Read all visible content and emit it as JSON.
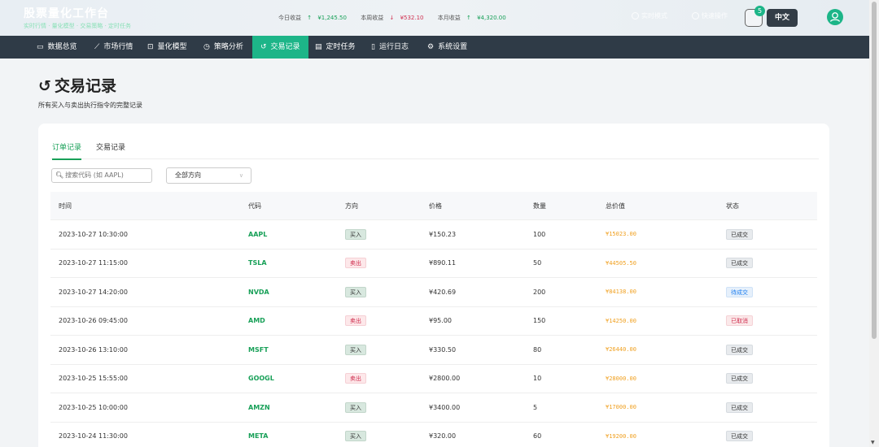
{
  "header": {
    "app_title": "股票量化工作台",
    "subtitle_links": "实时行情 · 量化模型 · 交易策略 · 定时任务",
    "stats": [
      {
        "label": "今日收益",
        "arrow": "↑",
        "value": "¥1,245.50",
        "trend": "up"
      },
      {
        "label": "本周收益",
        "arrow": "↓",
        "value": "¥532.10",
        "trend": "down"
      },
      {
        "label": "本月收益",
        "arrow": "↑",
        "value": "¥4,320.00",
        "trend": "up"
      }
    ],
    "ghost_action_1": "实时模式",
    "ghost_action_2": "快速操作",
    "notification_count": "5",
    "language_button": "中文",
    "avatar_icon": "user-icon"
  },
  "nav": {
    "items": [
      {
        "label": "数据总览",
        "icon": "monitor-icon",
        "glyph": "▭"
      },
      {
        "label": "市场行情",
        "icon": "trend-icon",
        "glyph": "⟋"
      },
      {
        "label": "量化模型",
        "icon": "chart-icon",
        "glyph": "⊡"
      },
      {
        "label": "策略分析",
        "icon": "clock-icon",
        "glyph": "◷"
      },
      {
        "label": "交易记录",
        "icon": "history-icon",
        "glyph": "↺"
      },
      {
        "label": "定时任务",
        "icon": "calendar-icon",
        "glyph": "▤"
      },
      {
        "label": "运行日志",
        "icon": "file-icon",
        "glyph": "▯"
      },
      {
        "label": "系统设置",
        "icon": "gear-icon",
        "glyph": "⚙"
      }
    ],
    "active_index": 4
  },
  "page": {
    "title": "交易记录",
    "title_icon": "↺",
    "description": "所有买入与卖出执行指令的完整记录"
  },
  "tabs": {
    "items": [
      "订单记录",
      "交易记录"
    ],
    "active_index": 0
  },
  "filters": {
    "search_placeholder": "搜索代码 (如 AAPL)",
    "direction_value": "全部方向"
  },
  "table": {
    "columns": [
      "时间",
      "代码",
      "方向",
      "价格",
      "数量",
      "总价值",
      "状态"
    ],
    "rows": [
      {
        "time": "2023-10-27 10:30:00",
        "code": "AAPL",
        "direction": "买入",
        "price": "¥150.23",
        "qty": "100",
        "total": "¥15023.00",
        "status": "已成交"
      },
      {
        "time": "2023-10-27 11:15:00",
        "code": "TSLA",
        "direction": "卖出",
        "price": "¥890.11",
        "qty": "50",
        "total": "¥44505.50",
        "status": "已成交"
      },
      {
        "time": "2023-10-27 14:20:00",
        "code": "NVDA",
        "direction": "买入",
        "price": "¥420.69",
        "qty": "200",
        "total": "¥84138.00",
        "status": "待成交"
      },
      {
        "time": "2023-10-26 09:45:00",
        "code": "AMD",
        "direction": "卖出",
        "price": "¥95.00",
        "qty": "150",
        "total": "¥14250.00",
        "status": "已取消"
      },
      {
        "time": "2023-10-26 13:10:00",
        "code": "MSFT",
        "direction": "买入",
        "price": "¥330.50",
        "qty": "80",
        "total": "¥26440.00",
        "status": "已成交"
      },
      {
        "time": "2023-10-25 15:55:00",
        "code": "GOOGL",
        "direction": "卖出",
        "price": "¥2800.00",
        "qty": "10",
        "total": "¥28000.00",
        "status": "已成交"
      },
      {
        "time": "2023-10-25 10:00:00",
        "code": "AMZN",
        "direction": "买入",
        "price": "¥3400.00",
        "qty": "5",
        "total": "¥17000.00",
        "status": "已成交"
      },
      {
        "time": "2023-10-24 11:30:00",
        "code": "META",
        "direction": "买入",
        "price": "¥320.00",
        "qty": "60",
        "total": "¥19200.00",
        "status": "已成交"
      }
    ]
  },
  "colors": {
    "accent": "#1db588",
    "nav_bg": "#2f3b47",
    "buy_text": "#333333",
    "sell_text": "#d03050",
    "total_text": "#f0a020"
  }
}
